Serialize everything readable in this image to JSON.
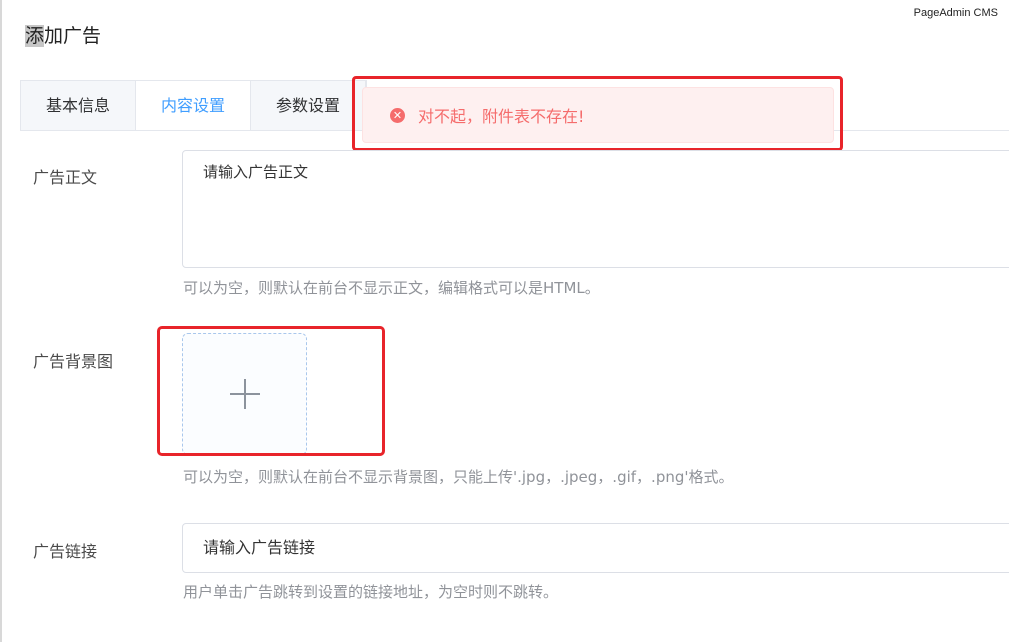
{
  "brand": "PageAdmin CMS",
  "page_title": {
    "highlight": "添",
    "rest": "加广告"
  },
  "tabs": [
    {
      "label": "基本信息",
      "active": false
    },
    {
      "label": "内容设置",
      "active": true
    },
    {
      "label": "参数设置",
      "active": false
    }
  ],
  "toast": {
    "icon": "error-circle-icon",
    "text": "对不起，附件表不存在!",
    "color": "#f56c6c"
  },
  "form": {
    "body": {
      "label": "广告正文",
      "placeholder": "请输入广告正文",
      "hint": "可以为空，则默认在前台不显示正文，编辑格式可以是HTML。"
    },
    "background": {
      "label": "广告背景图",
      "upload_icon": "plus-icon",
      "hint": "可以为空，则默认在前台不显示背景图，只能上传'.jpg，.jpeg，.gif，.png'格式。"
    },
    "link": {
      "label": "广告链接",
      "placeholder": "请输入广告链接",
      "hint": "用户单击广告跳转到设置的链接地址，为空时则不跳转。"
    }
  },
  "colors": {
    "accent": "#409eff",
    "error": "#f56c6c",
    "annotation": "#e8242a"
  }
}
